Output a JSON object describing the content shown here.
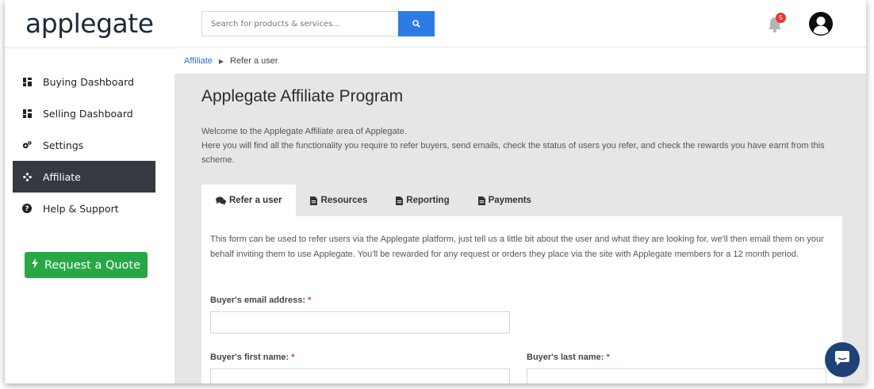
{
  "brand": {
    "logo": "applegate"
  },
  "sidebar": {
    "items": [
      {
        "label": "Buying Dashboard",
        "icon": "dashboard-icon",
        "active": false
      },
      {
        "label": "Selling Dashboard",
        "icon": "dashboard-icon",
        "active": false
      },
      {
        "label": "Settings",
        "icon": "gears-icon",
        "active": false
      },
      {
        "label": "Affiliate",
        "icon": "affiliate-icon",
        "active": true
      },
      {
        "label": "Help & Support",
        "icon": "question-circle-icon",
        "active": false
      }
    ],
    "quote_button": "Request a Quote"
  },
  "header": {
    "search_placeholder": "Search for products & services...",
    "notification_count": "5"
  },
  "breadcrumb": {
    "parent": "Affiliate",
    "current": "Refer a user"
  },
  "main": {
    "title": "Applegate Affiliate Program",
    "intro_line1": "Welcome to the Applegate Affiliate area of Applegate.",
    "intro_line2": "Here you will find all the functionality you require to refer buyers, send emails, check the status of users you refer, and check the rewards you have earnt from this scheme.",
    "tabs": [
      {
        "label": "Refer a user",
        "icon": "comments-icon",
        "active": true
      },
      {
        "label": "Resources",
        "icon": "file-icon",
        "active": false
      },
      {
        "label": "Reporting",
        "icon": "file-icon",
        "active": false
      },
      {
        "label": "Payments",
        "icon": "file-icon",
        "active": false
      }
    ],
    "form": {
      "description": "This form can be used to refer users via the Applegate platform, just tell us a little bit about the user and what they are looking for, we'll then email them on your behalf inviting them to use Applegate. You'll be rewarded for any request or orders they place via the site with Applegate members for a 12 month period.",
      "email_label": "Buyer's email address:",
      "first_name_label": "Buyer's first name:",
      "last_name_label": "Buyer's last name:",
      "required_mark": "*",
      "email_value": "",
      "first_name_value": "",
      "last_name_value": ""
    }
  },
  "colors": {
    "accent_blue": "#2d7be5",
    "quote_green": "#28a745",
    "sidebar_active": "#343a40",
    "required_red": "#e53935",
    "chat_navy": "#1d4278"
  }
}
